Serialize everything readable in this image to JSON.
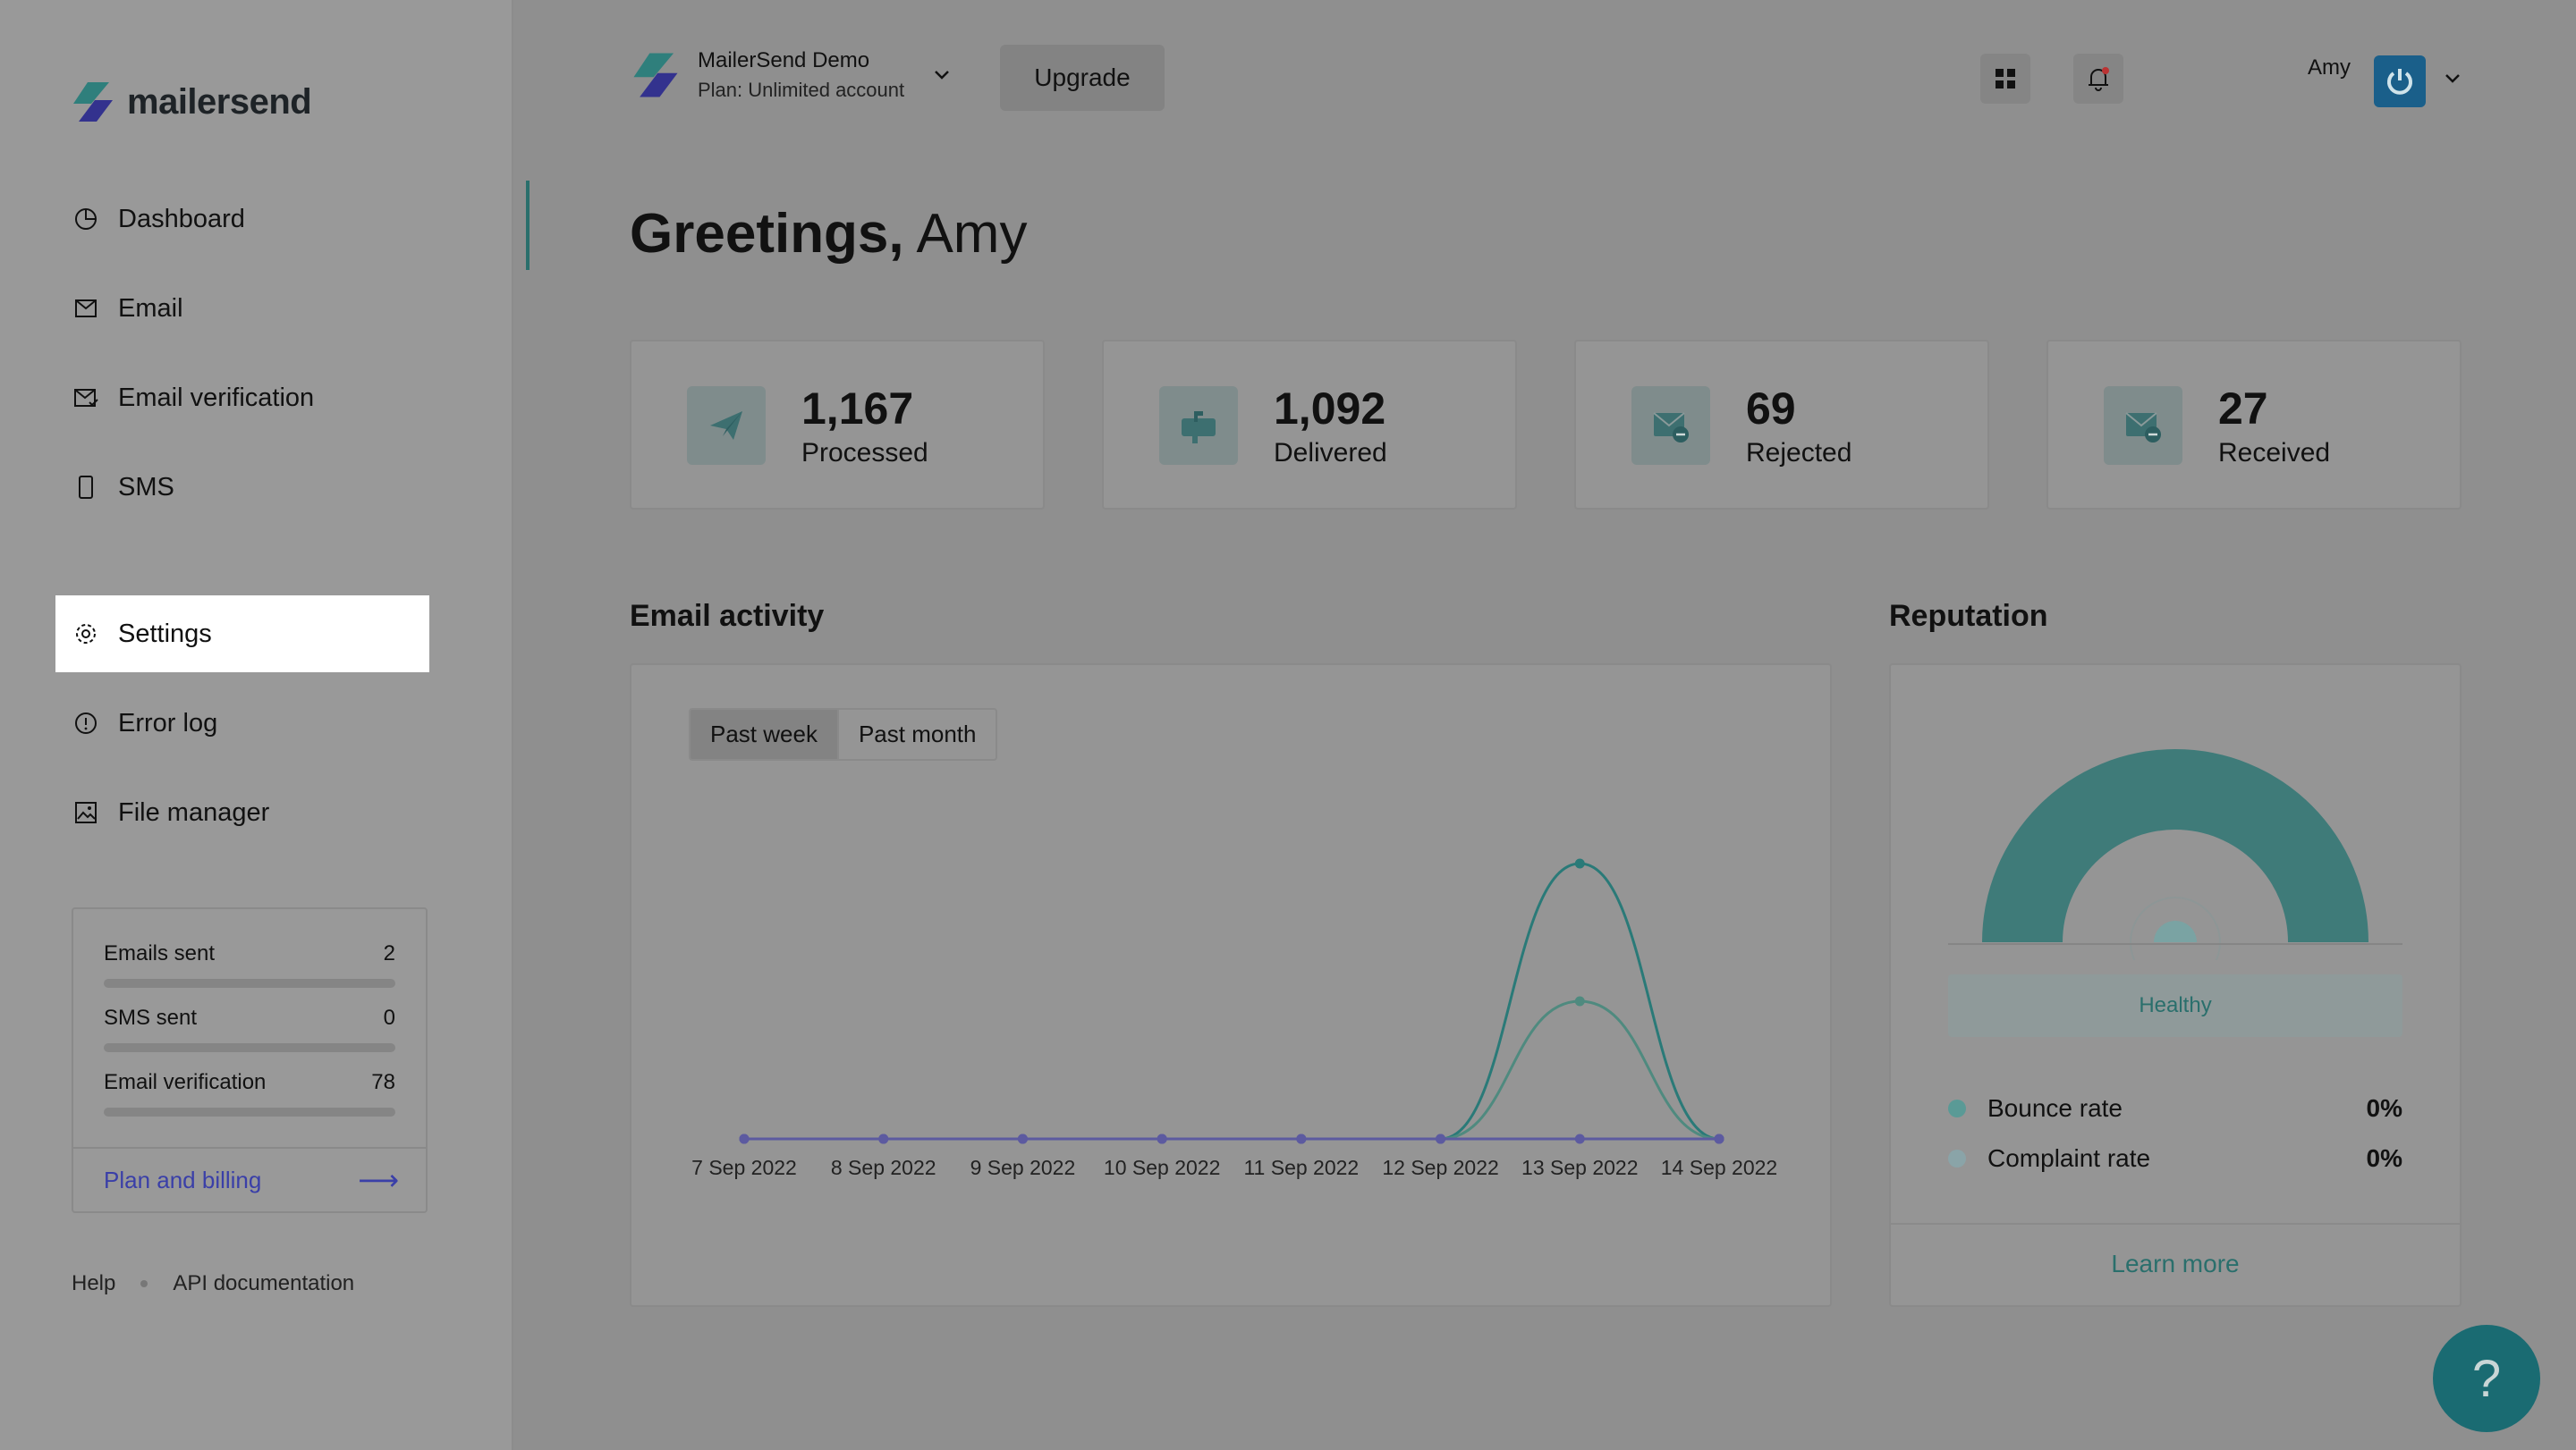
{
  "brand": {
    "name": "mailersend"
  },
  "sidebar": {
    "items": [
      {
        "label": "Dashboard",
        "icon": "dashboard-icon"
      },
      {
        "label": "Email",
        "icon": "email-icon"
      },
      {
        "label": "Email verification",
        "icon": "email-verification-icon"
      },
      {
        "label": "SMS",
        "icon": "sms-icon"
      },
      {
        "label": "Settings",
        "icon": "gear-icon"
      },
      {
        "label": "Error log",
        "icon": "alert-circle-icon"
      },
      {
        "label": "File manager",
        "icon": "image-icon"
      }
    ],
    "usage": [
      {
        "label": "Emails sent",
        "value": "2"
      },
      {
        "label": "SMS sent",
        "value": "0"
      },
      {
        "label": "Email verification",
        "value": "78"
      }
    ],
    "plan_link": "Plan and billing",
    "footer": {
      "help": "Help",
      "api": "API documentation"
    }
  },
  "topbar": {
    "account_name": "MailerSend Demo",
    "account_plan": "Plan: Unlimited account",
    "upgrade_label": "Upgrade",
    "user_name": "Amy"
  },
  "greeting": {
    "prefix": "Greetings,",
    "name": "Amy"
  },
  "stats": [
    {
      "value": "1,167",
      "label": "Processed",
      "icon": "paper-plane-icon"
    },
    {
      "value": "1,092",
      "label": "Delivered",
      "icon": "mailbox-icon"
    },
    {
      "value": "69",
      "label": "Rejected",
      "icon": "mail-minus-icon"
    },
    {
      "value": "27",
      "label": "Received",
      "icon": "mail-minus-icon"
    }
  ],
  "email_activity": {
    "title": "Email activity",
    "tabs": [
      "Past week",
      "Past month"
    ],
    "active_tab": "Past week"
  },
  "chart_data": {
    "type": "line",
    "categories": [
      "7 Sep 2022",
      "8 Sep 2022",
      "9 Sep 2022",
      "10 Sep 2022",
      "11 Sep 2022",
      "12 Sep 2022",
      "13 Sep 2022",
      "14 Sep 2022"
    ],
    "series": [
      {
        "values": [
          0,
          0,
          0,
          0,
          0,
          0,
          2,
          0
        ],
        "color": "#2a7a78"
      },
      {
        "values": [
          0,
          0,
          0,
          0,
          0,
          0,
          1,
          0
        ],
        "color": "#4f8a7f"
      },
      {
        "values": [
          0,
          0,
          0,
          0,
          0,
          0,
          0,
          0
        ],
        "color": "#5c5aa0"
      }
    ],
    "grid": false,
    "legend": "none"
  },
  "reputation": {
    "title": "Reputation",
    "status": "Healthy",
    "rows": [
      {
        "label": "Bounce rate",
        "value": "0%",
        "color": "#5a9a96"
      },
      {
        "label": "Complaint rate",
        "value": "0%",
        "color": "#8aa4a8"
      }
    ],
    "learn_more": "Learn more",
    "gauge_color": "#3f7b79"
  },
  "help_fab": "?"
}
